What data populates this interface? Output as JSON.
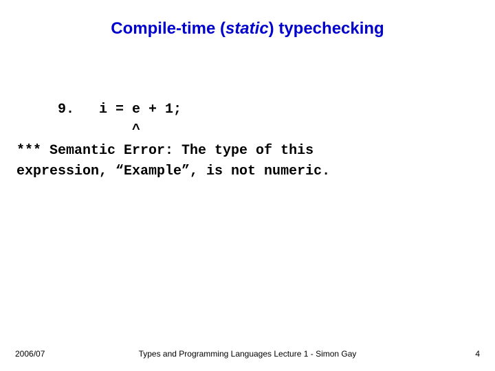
{
  "title": {
    "prefix": "Compile-time (",
    "italic": "static",
    "suffix": ") typechecking"
  },
  "code": {
    "line1": "     9.   i = e + 1;",
    "line2": "              ^",
    "line3": "*** Semantic Error: The type of this",
    "line4": "expression, “Example”, is not numeric."
  },
  "footer": {
    "left": "2006/07",
    "center": "Types and Programming Languages Lecture 1 - Simon Gay",
    "right": "4"
  }
}
